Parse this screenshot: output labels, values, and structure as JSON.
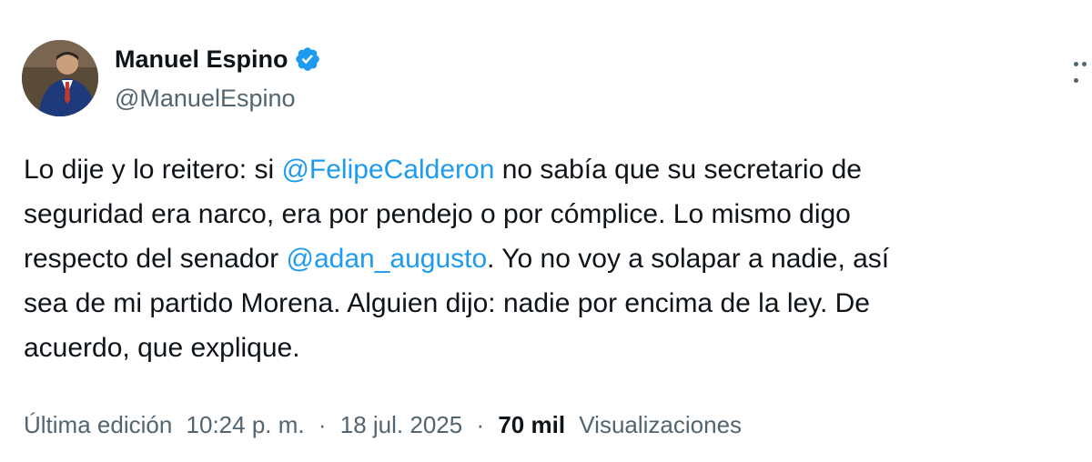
{
  "author": {
    "name": "Manuel Espino",
    "handle": "@ManuelEspino",
    "verified": true
  },
  "tweet": {
    "lines": [
      [
        {
          "text": "Lo dije y lo reitero: si ",
          "mention": false
        },
        {
          "text": "@FelipeCalderon",
          "mention": true
        },
        {
          "text": " no sabía que su secretario de",
          "mention": false
        }
      ],
      [
        {
          "text": "seguridad era narco, era por pendejo o por cómplice. Lo mismo digo",
          "mention": false
        }
      ],
      [
        {
          "text": "respecto del senador ",
          "mention": false
        },
        {
          "text": "@adan_augusto",
          "mention": true
        },
        {
          "text": ". Yo no voy a solapar a nadie, así",
          "mention": false
        }
      ],
      [
        {
          "text": "sea de mi partido Morena. Alguien dijo: nadie por encima de la ley. De",
          "mention": false
        }
      ],
      [
        {
          "text": "acuerdo, que explique.",
          "mention": false
        }
      ]
    ]
  },
  "meta": {
    "edited_label": "Última edición",
    "time": "10:24 p. m.",
    "separator": "·",
    "date": "18 jul. 2025",
    "views_count": "70 mil",
    "views_label": "Visualizaciones"
  },
  "colors": {
    "text": "#0f1419",
    "secondary": "#536471",
    "link": "#1d9bf0",
    "verified_badge": "#1d9bf0"
  }
}
